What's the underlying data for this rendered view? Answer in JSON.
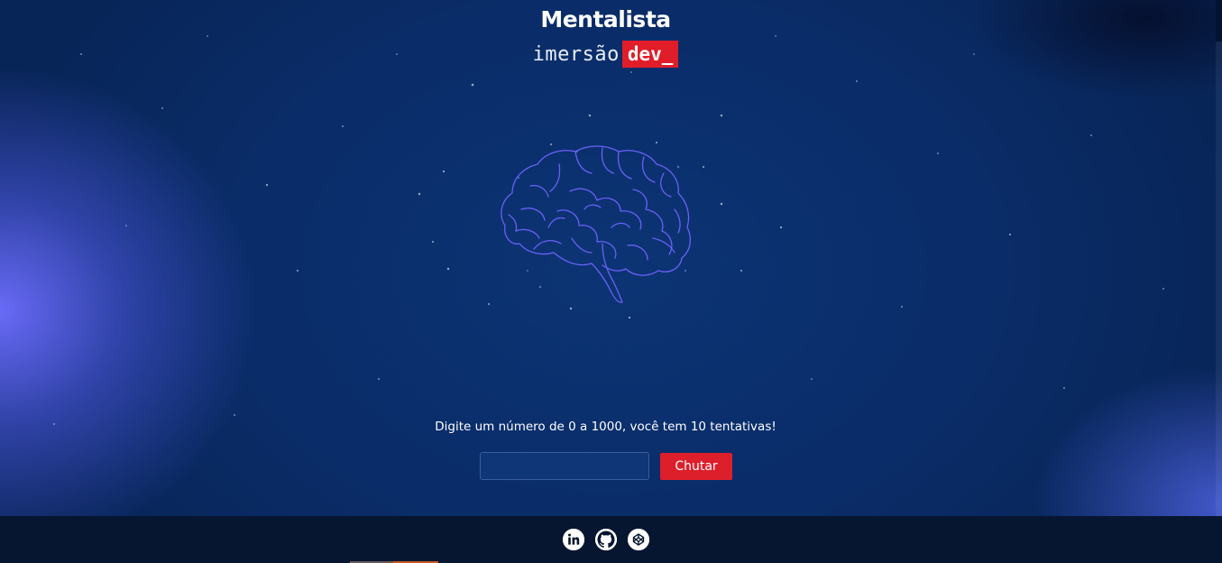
{
  "header": {
    "title": "Mentalista",
    "brand_text": "imersão",
    "brand_tag": "dev_"
  },
  "game": {
    "prompt": "Digite um número de 0 a 1000, você tem 10 tentativas!",
    "input_value": "",
    "input_placeholder": "",
    "guess_button_label": "Chutar"
  },
  "footer": {
    "links": [
      {
        "icon": "linkedin-icon"
      },
      {
        "icon": "github-icon"
      },
      {
        "icon": "codepen-icon"
      }
    ]
  },
  "colors": {
    "accent_red": "#dc1f2b",
    "background_blue": "#0a2c68",
    "footer_bg": "#061631",
    "brain_stroke": "#6f63ff"
  }
}
